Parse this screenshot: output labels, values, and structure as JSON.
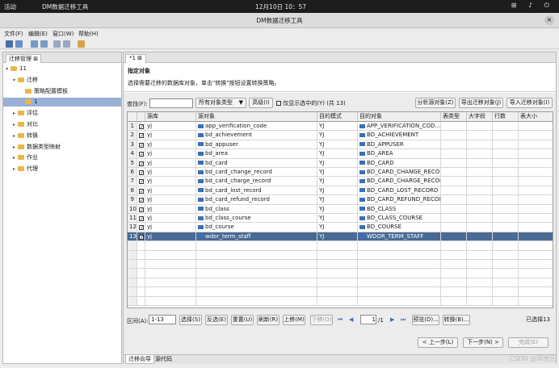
{
  "topbar": {
    "activities": "活动",
    "app": "DM数据迁移工具",
    "clock": "12月10日 10：57",
    "sys": "⊞ ♪ ⏻"
  },
  "window": {
    "title": "DM数据迁移工具",
    "close": "×"
  },
  "menu": [
    "文件(F)",
    "编辑(E)",
    "窗口(W)",
    "帮助(H)"
  ],
  "left_panel": {
    "tab": "迁移管理 ⊠",
    "tree": [
      {
        "label": "11",
        "level": 0,
        "open": true
      },
      {
        "label": "迁移",
        "level": 1,
        "open": true
      },
      {
        "label": "策略配置模板",
        "level": 2
      },
      {
        "label": "1",
        "level": 2,
        "selected": true
      },
      {
        "label": "评估",
        "level": 1
      },
      {
        "label": "对比",
        "level": 1
      },
      {
        "label": "转换",
        "level": 1
      },
      {
        "label": "数据类型映射",
        "level": 1
      },
      {
        "label": "作业",
        "level": 1
      },
      {
        "label": "代理",
        "level": 1
      }
    ]
  },
  "right_panel": {
    "tab": "*1 ⊠",
    "heading": "指定对象",
    "desc": "选择需要迁移的数据库对象，单击\"转换\"按钮设置转换策略。",
    "search_label": "查找(F):",
    "search_value": "",
    "type_select": "所有对象类型",
    "advanced": "高级(I)",
    "only_selected": "仅显示选中的(Y)  (共 13)",
    "analyze": "分析源对象(Z)",
    "export": "导出迁移对象(J)",
    "import": "导入迁移对象(I)",
    "columns": [
      "",
      "",
      "源库",
      "源对象",
      "目的模式",
      "目的对象",
      "表类型",
      "大字段",
      "行数",
      "表大小"
    ],
    "rows": [
      {
        "n": "1",
        "src": "yj",
        "obj": "app_verification_code",
        "schema": "YJ",
        "dst": "APP_VERIFICATION_COD..."
      },
      {
        "n": "2",
        "src": "yj",
        "obj": "bd_achievement",
        "schema": "YJ",
        "dst": "BD_ACHIEVEMENT"
      },
      {
        "n": "3",
        "src": "yj",
        "obj": "bd_appuser",
        "schema": "YJ",
        "dst": "BD_APPUSER"
      },
      {
        "n": "4",
        "src": "yj",
        "obj": "bd_area",
        "schema": "YJ",
        "dst": "BD_AREA"
      },
      {
        "n": "5",
        "src": "yj",
        "obj": "bd_card",
        "schema": "YJ",
        "dst": "BD_CARD"
      },
      {
        "n": "6",
        "src": "yj",
        "obj": "bd_card_change_record",
        "schema": "YJ",
        "dst": "BD_CARD_CHANGE_RECOI"
      },
      {
        "n": "7",
        "src": "yj",
        "obj": "bd_card_charge_record",
        "schema": "YJ",
        "dst": "BD_CARD_CHARGE_RECOI"
      },
      {
        "n": "8",
        "src": "yj",
        "obj": "bd_card_lost_record",
        "schema": "YJ",
        "dst": "BD_CARD_LOST_RECORD"
      },
      {
        "n": "9",
        "src": "yj",
        "obj": "bd_card_refund_record",
        "schema": "YJ",
        "dst": "BD_CARD_REFUND_RECOI"
      },
      {
        "n": "10",
        "src": "yj",
        "obj": "bd_class",
        "schema": "YJ",
        "dst": "BD_CLASS"
      },
      {
        "n": "11",
        "src": "yj",
        "obj": "bd_class_course",
        "schema": "YJ",
        "dst": "BD_CLASS_COURSE"
      },
      {
        "n": "12",
        "src": "yj",
        "obj": "bd_course",
        "schema": "YJ",
        "dst": "BD_COURSE"
      },
      {
        "n": "13",
        "src": "yj",
        "obj": "wdor_term_staff",
        "schema": "YJ",
        "dst": "WDOR_TERM_STAFF",
        "highlight": true
      }
    ],
    "range_label": "区间(A):",
    "range_value": "1-13",
    "buttons": [
      "选择(S)",
      "反选(E)",
      "重置(U)",
      "刷新(R)",
      "上移(M)",
      "下移(O)"
    ],
    "page_value": "1",
    "page_total": "/1",
    "preview": "预览(D)...",
    "transform": "转换(B)...",
    "selected_count": "已选择13",
    "prev": "< 上一步(L)",
    "next": "下一步(N) >",
    "finish": "完成(E)",
    "bottom_tabs": [
      "迁移向导",
      "源代码"
    ]
  },
  "watermark": "CSDN @风络豆",
  "colors": {
    "highlight": "#4a6a95",
    "selected_tree": "#9ab0d4",
    "folder": "#e8b84c"
  }
}
